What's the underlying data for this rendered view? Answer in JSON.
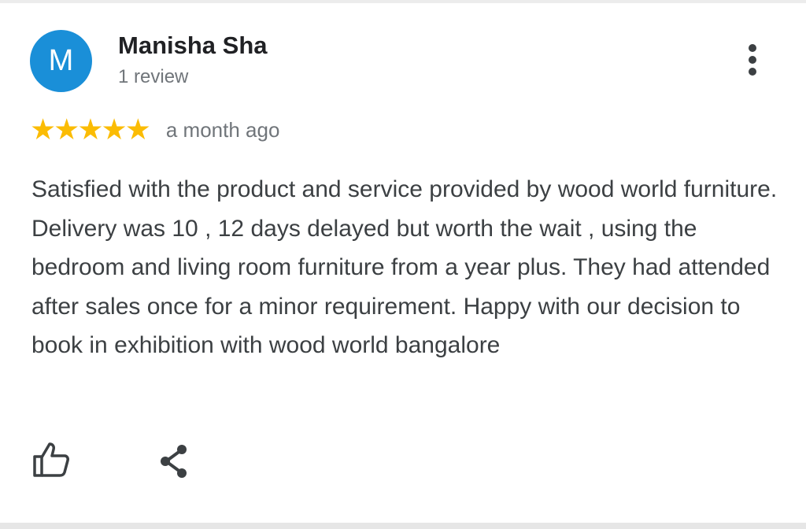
{
  "review": {
    "avatar_initial": "M",
    "reviewer_name": "Manisha Sha",
    "review_count": "1 review",
    "rating": 5,
    "rating_max": 5,
    "timestamp": "a month ago",
    "text": "Satisfied with the product and service provided by wood world furniture. Delivery was 10 , 12 days delayed but worth the wait , using the bedroom and living room furniture from a year plus. They had attended after sales once for a minor requirement. Happy with our decision to book in exhibition with wood world bangalore"
  },
  "colors": {
    "avatar_bg": "#1a8fd8",
    "star": "#fbbc04",
    "text": "#3c4043",
    "muted": "#70757a"
  },
  "icons": {
    "menu": "more-vert-icon",
    "like": "thumb-up-icon",
    "share": "share-icon"
  }
}
